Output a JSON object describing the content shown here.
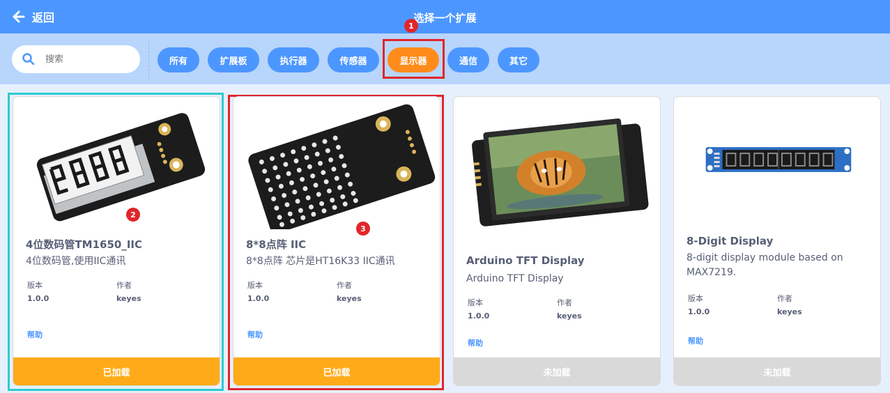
{
  "header": {
    "back_label": "返回",
    "title": "选择一个扩展"
  },
  "search": {
    "placeholder": "搜索"
  },
  "tags": [
    "所有",
    "扩展板",
    "执行器",
    "传感器",
    "显示器",
    "通信",
    "其它"
  ],
  "active_tag": "显示器",
  "badges": [
    "1",
    "2",
    "3"
  ],
  "meta_labels": {
    "version": "版本",
    "author": "作者"
  },
  "cards": [
    {
      "title": "4位数码管TM1650_IIC",
      "desc": "4位数码管,使用IIC通讯",
      "version": "1.0.0",
      "author": "keyes",
      "help": "帮助",
      "status": "已加载"
    },
    {
      "title": "8*8点阵 IIC",
      "desc": "8*8点阵 芯片是HT16K33 IIC通讯",
      "version": "1.0.0",
      "author": "keyes",
      "help": "帮助",
      "status": "已加载"
    },
    {
      "title": "Arduino TFT Display",
      "desc": "Arduino TFT Display",
      "version": "1.0.0",
      "author": "keyes",
      "help": "帮助",
      "status": "未加载"
    },
    {
      "title": "8-Digit Display",
      "desc": "8-digit display module based on MAX7219.",
      "version": "1.0.0",
      "author": "keyes",
      "help": "帮助",
      "status": "未加载"
    }
  ],
  "colors": {
    "header": "#4c97ff",
    "filterbar": "#b8d5fc",
    "active_tag": "#ff8c1a",
    "loaded": "#ffab19",
    "unloaded": "#d9d9d9",
    "highlight_red": "#e0262b",
    "highlight_cyan": "#2ecbd0"
  }
}
